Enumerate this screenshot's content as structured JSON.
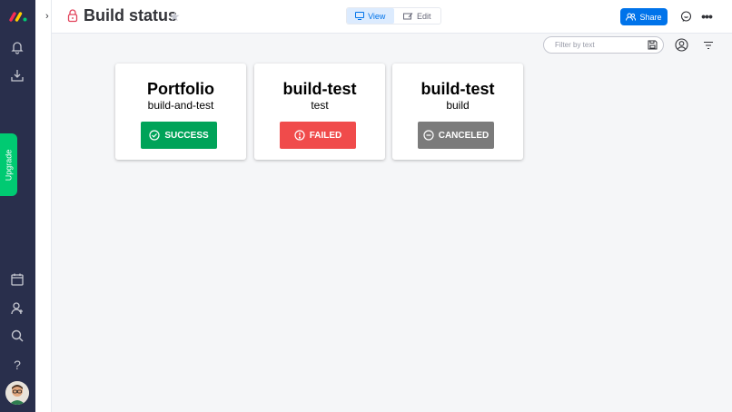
{
  "header": {
    "title": "Build status",
    "view_label": "View",
    "edit_label": "Edit",
    "share_label": "Share"
  },
  "sidebar": {
    "upgrade_label": "Upgrade"
  },
  "toolbar": {
    "filter_placeholder": "Filter by text"
  },
  "cards": [
    {
      "title": "Portfolio",
      "subtitle": "build-and-test",
      "status": "SUCCESS",
      "status_color": "#00a359",
      "icon": "check-circle-icon"
    },
    {
      "title": "build-test",
      "subtitle": "test",
      "status": "FAILED",
      "status_color": "#f04b4b",
      "icon": "alert-circle-icon"
    },
    {
      "title": "build-test",
      "subtitle": "build",
      "status": "CANCELED",
      "status_color": "#7b7b7b",
      "icon": "minus-circle-icon"
    }
  ],
  "colors": {
    "nav_bg": "#292f4c",
    "accent": "#0073ea",
    "upgrade": "#00ca72",
    "page_bg": "#f5f6f8"
  }
}
